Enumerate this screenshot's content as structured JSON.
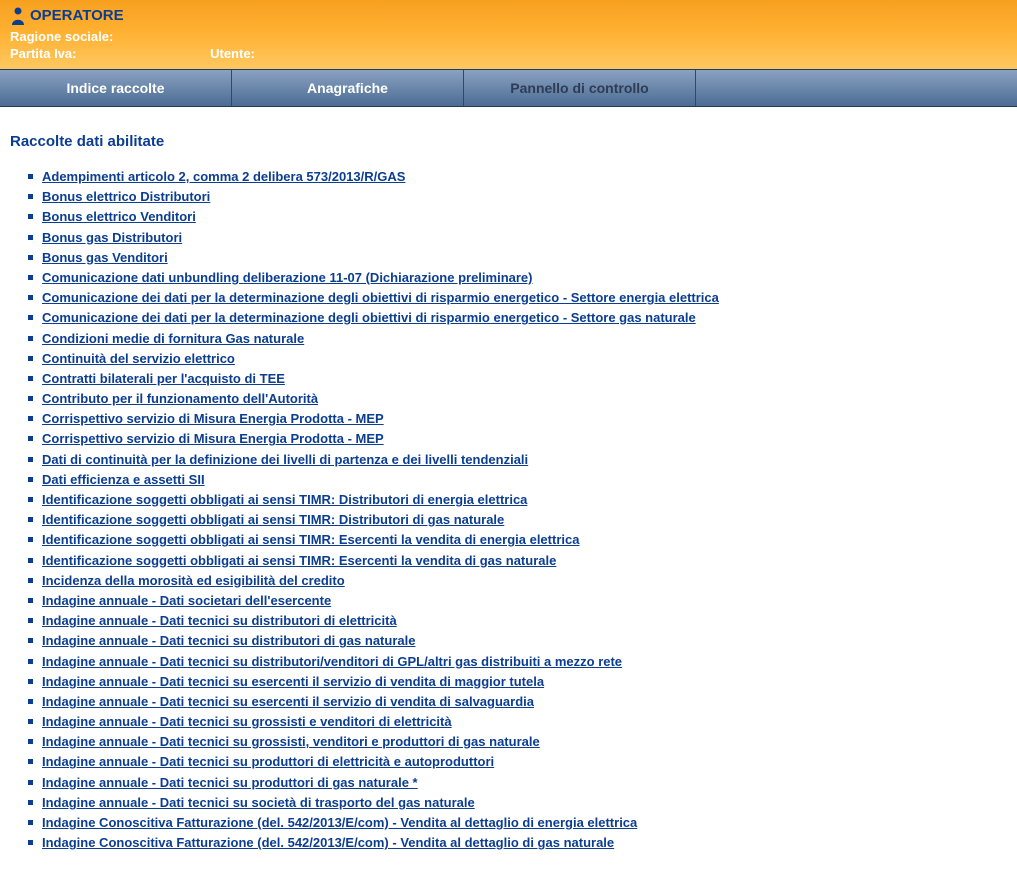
{
  "header": {
    "title": "OPERATORE",
    "ragione_sociale_label": "Ragione sociale:",
    "partita_iva_label": "Partita Iva:",
    "utente_label": "Utente:"
  },
  "navbar": {
    "tabs": [
      {
        "label": "Indice raccolte",
        "active": true
      },
      {
        "label": "Anagrafiche",
        "active": true
      },
      {
        "label": "Pannello di controllo",
        "active": false
      }
    ]
  },
  "section_title": "Raccolte dati abilitate",
  "links": [
    "Adempimenti articolo 2, comma 2 delibera 573/2013/R/GAS",
    "Bonus elettrico Distributori",
    "Bonus elettrico Venditori",
    "Bonus gas Distributori",
    "Bonus gas Venditori",
    "Comunicazione dati unbundling deliberazione 11-07 (Dichiarazione preliminare)",
    "Comunicazione dei dati per la determinazione degli obiettivi di risparmio energetico - Settore energia elettrica",
    "Comunicazione dei dati per la determinazione degli obiettivi di risparmio energetico - Settore gas naturale",
    "Condizioni medie di fornitura Gas naturale",
    "Continuità del servizio elettrico",
    "Contratti bilaterali per l'acquisto di TEE",
    "Contributo per il funzionamento dell'Autorità",
    "Corrispettivo servizio di Misura Energia Prodotta - MEP",
    "Corrispettivo servizio di Misura Energia Prodotta - MEP",
    "Dati di continuità per la definizione dei livelli di partenza e dei livelli tendenziali",
    "Dati efficienza e assetti SII",
    "Identificazione soggetti obbligati ai sensi TIMR: Distributori di energia elettrica",
    "Identificazione soggetti obbligati ai sensi TIMR: Distributori di gas naturale",
    "Identificazione soggetti obbligati ai sensi TIMR: Esercenti la vendita di energia elettrica",
    "Identificazione soggetti obbligati ai sensi TIMR: Esercenti la vendita di gas naturale",
    "Incidenza della morosità ed esigibilità del credito",
    "Indagine annuale - Dati societari dell'esercente",
    "Indagine annuale - Dati tecnici su distributori di elettricità",
    "Indagine annuale - Dati tecnici su distributori di gas naturale",
    "Indagine annuale - Dati tecnici su distributori/venditori di GPL/altri gas distribuiti a mezzo rete",
    "Indagine annuale - Dati tecnici su esercenti il servizio di vendita di maggior tutela",
    "Indagine annuale - Dati tecnici su esercenti il servizio di vendita di salvaguardia",
    "Indagine annuale - Dati tecnici su grossisti e venditori di elettricità",
    "Indagine annuale - Dati tecnici su grossisti, venditori e produttori di gas naturale",
    "Indagine annuale - Dati tecnici su produttori di elettricità e autoproduttori",
    "Indagine annuale - Dati tecnici su produttori di gas naturale *",
    "Indagine annuale - Dati tecnici su società di trasporto del gas naturale",
    "Indagine Conoscitiva Fatturazione (del. 542/2013/E/com) - Vendita al dettaglio di energia elettrica",
    "Indagine Conoscitiva Fatturazione (del. 542/2013/E/com) - Vendita al dettaglio di gas naturale"
  ]
}
